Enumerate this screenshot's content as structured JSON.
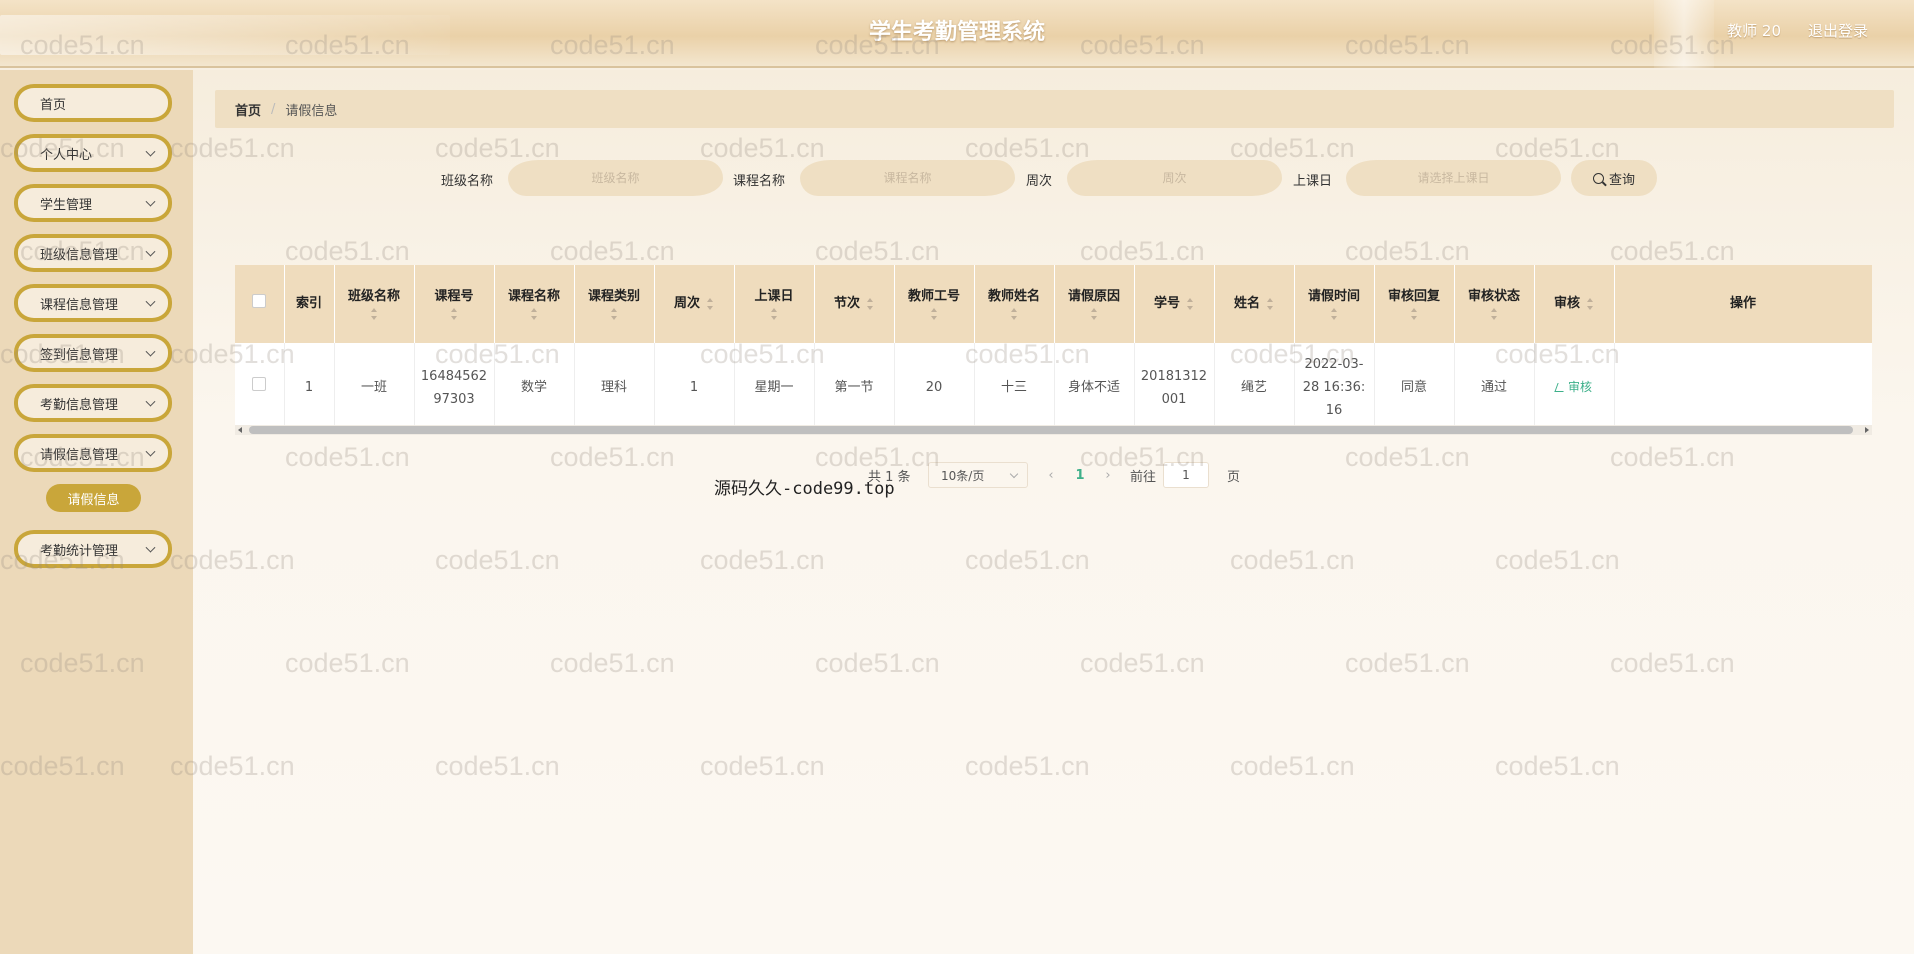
{
  "header": {
    "title": "学生考勤管理系统",
    "user": "教师 20",
    "logout": "退出登录"
  },
  "sidebar": {
    "items": [
      {
        "label": "首页",
        "has_chevron": false
      },
      {
        "label": "个人中心",
        "has_chevron": true
      },
      {
        "label": "学生管理",
        "has_chevron": true
      },
      {
        "label": "班级信息管理",
        "has_chevron": true
      },
      {
        "label": "课程信息管理",
        "has_chevron": true
      },
      {
        "label": "签到信息管理",
        "has_chevron": true
      },
      {
        "label": "考勤信息管理",
        "has_chevron": true
      },
      {
        "label": "请假信息管理",
        "has_chevron": true
      },
      {
        "label": "考勤统计管理",
        "has_chevron": true
      }
    ],
    "active_submenu": "请假信息"
  },
  "breadcrumb": {
    "home": "首页",
    "separator": "/",
    "current": "请假信息"
  },
  "search": {
    "fields": [
      {
        "label": "班级名称",
        "placeholder": "班级名称"
      },
      {
        "label": "课程名称",
        "placeholder": "课程名称"
      },
      {
        "label": "周次",
        "placeholder": "周次"
      },
      {
        "label": "上课日",
        "placeholder": "请选择上课日"
      }
    ],
    "button": "查询"
  },
  "table": {
    "columns": [
      "索引",
      "班级名称",
      "课程号",
      "课程名称",
      "课程类别",
      "周次",
      "上课日",
      "节次",
      "教师工号",
      "教师姓名",
      "请假原因",
      "学号",
      "姓名",
      "请假时间",
      "审核回复",
      "审核状态",
      "审核",
      "操作"
    ],
    "rows": [
      {
        "index": "1",
        "class_name": "一班",
        "course_no": "1648456297303",
        "course_name": "数学",
        "course_type": "理科",
        "week": "1",
        "day": "星期一",
        "section": "第一节",
        "teacher_no": "20",
        "teacher_name": "十三",
        "reason": "身体不适",
        "student_no": "20181312001",
        "student_name": "绳艺",
        "leave_time": "2022-03-28 16:36:16",
        "reply": "同意",
        "status": "通过",
        "audit_action": "审核"
      }
    ]
  },
  "pagination": {
    "total": "共 1 条",
    "page_size": "10条/页",
    "current_page": "1",
    "goto_label": "前往",
    "goto_value": "1",
    "page_suffix": "页"
  },
  "overlay_text": "源码久久-code99.top",
  "watermark": "code51.cn",
  "colors": {
    "accent": "#c9a63a",
    "header_bg": "#ead1a8",
    "table_header_bg": "#efdcbd",
    "link_green": "#3eb08a"
  }
}
